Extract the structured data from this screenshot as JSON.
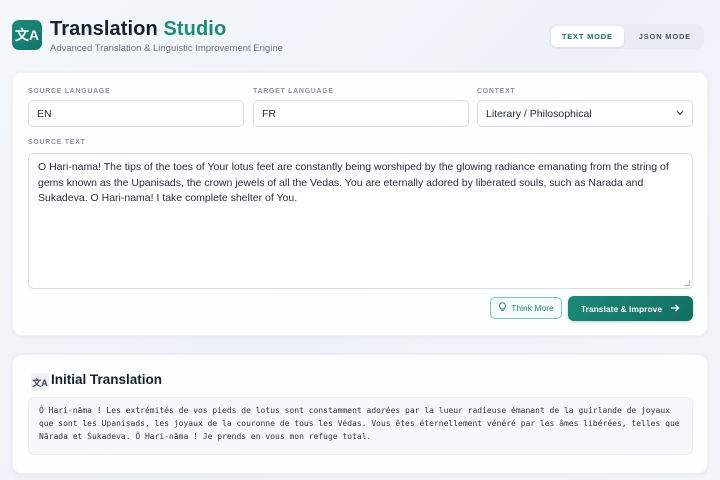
{
  "app": {
    "logo_glyph": "文A",
    "title_main": "Translation ",
    "title_accent": "Studio",
    "subtitle": "Advanced Translation & Linguistic Improvement Engine"
  },
  "modes": [
    {
      "label": "TEXT MODE",
      "active": true
    },
    {
      "label": "JSON MODE",
      "active": false
    }
  ],
  "form": {
    "source_language": {
      "label": "SOURCE LANGUAGE",
      "value": "EN"
    },
    "target_language": {
      "label": "TARGET LANGUAGE",
      "value": "FR"
    },
    "context": {
      "label": "CONTEXT",
      "value": "Literary / Philosophical"
    },
    "source_text": {
      "label": "SOURCE TEXT",
      "value": "O Hari-nama! The tips of the toes of Your lotus feet are constantly being worshiped by the glowing radiance emanating from the string of gems known as the Upanisads, the crown jewels of all the Vedas. You are eternally adored by liberated souls, such as Narada and Sukadeva. O Hari-nama! I take complete shelter of You."
    },
    "think_more_label": "Think More",
    "translate_label": "Translate & Improve"
  },
  "output": {
    "icon_glyph": "文A",
    "title": "Initial Translation",
    "text": "Ô Hari-nāma ! Les extrémités de vos pieds de lotus sont constamment adorées par la lueur radieuse émanant de la guirlande de joyaux que sont les Upaniṣads, les joyaux de la couronne de tous les Védas. Vous êtes éternellement vénéré par les âmes libérées, telles que Nārada et Śukadeva. Ô Hari-nāma ! Je prends en vous mon refuge total."
  },
  "colors": {
    "accent": "#1e8a78",
    "accent_dark": "#126e62"
  },
  "icons": {
    "logo": "translate-icon",
    "think": "lightbulb-icon",
    "translate": "arrow-right-icon",
    "select": "chevron-down-icon"
  }
}
